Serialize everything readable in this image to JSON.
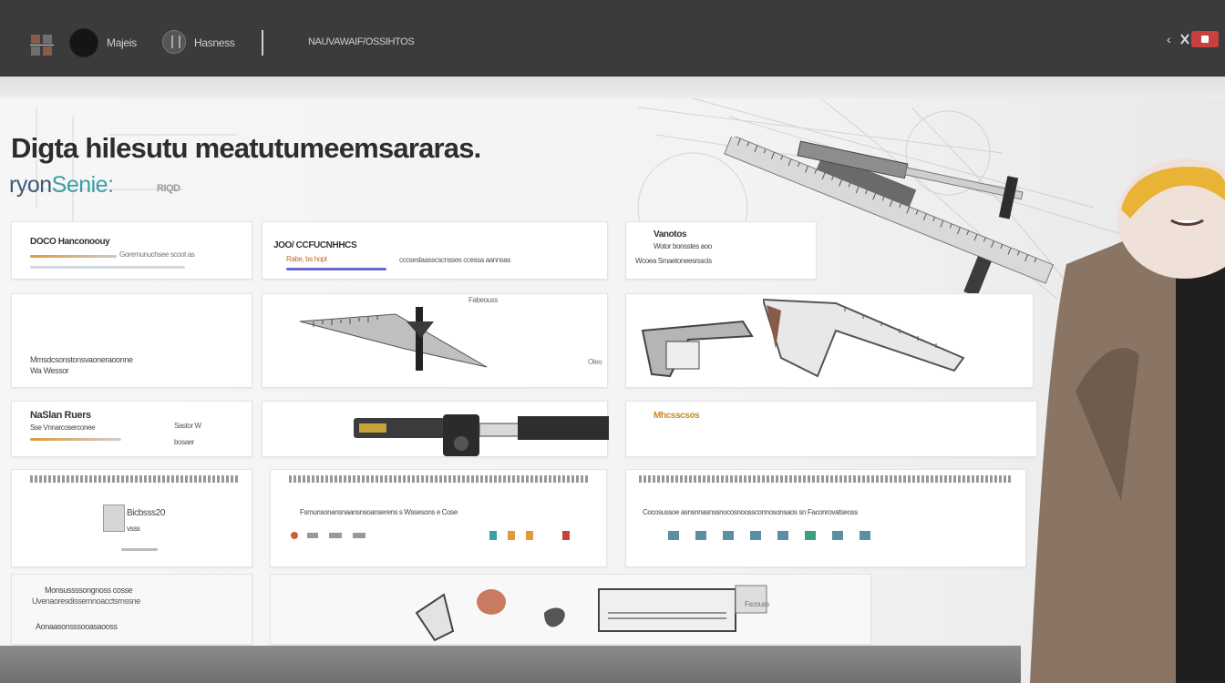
{
  "topbar": {
    "user_name": "Majeis",
    "brand_name": "Hasness",
    "nav_link": "NAUVAWAIF/OSSIHTOS",
    "icons": [
      "grid-logo-icon",
      "avatar",
      "brand-icon",
      "back-icon",
      "tools-icon",
      "record-icon"
    ]
  },
  "hero": {
    "headline": "Digta hilesutu meatutumeemsararas.",
    "subline_a": "ryon",
    "subline_b": "Senie:",
    "badge": "RIQD"
  },
  "cards": {
    "c1": {
      "title": "DOCO Hanconoouy",
      "line": "Gorernunuchsee scoot as"
    },
    "c2": {
      "title": "JOO/ CCFUCNHHCS",
      "line_a": "Rabe, bs hopt",
      "line_b": "cccseslaasscscnsses ccessa aannsas"
    },
    "c3": {
      "title": "Vanotos",
      "line_a": "Wotor bonsstes aoo",
      "line_b": "Wcoea Smaetoneesrsscis"
    },
    "c4": {
      "line_a": "Mmsdcsonstonsvaoneraoonne",
      "line_b": "Wa Wessor"
    },
    "c5": {
      "caption": "Fabeouss"
    },
    "c6": {
      "caption": "Oleo"
    },
    "c7": {
      "title": "NaSlan Ruers",
      "line_a": "Sse Vnnarcoserconee",
      "chip_a": "Sastor W",
      "chip_b": "bosaer"
    },
    "c8": {
      "label": "Mhcsscsos"
    },
    "c9": {
      "title": "Bicbsss20",
      "line": "vsss"
    },
    "c10": {
      "line": "Fsmunsonansnaansnsoanserens s Wssesons e Cose"
    },
    "c11": {
      "line": "Cocosussoe asnsnnasnssnocosnoossconnosonsaos sn Faconrovatseoss"
    },
    "c12": {
      "line_a": "Monsussssongnoss cosse",
      "line_b": "Uvenaoresdissemnoacctsrnssne",
      "line_c": "Aonaasonsssooasaooss"
    },
    "c13": {
      "label": "Fscouss"
    }
  },
  "colors": {
    "topbar": "#3b3b3b",
    "accent_orange": "#e09a3a",
    "accent_teal": "#3a9ea7",
    "accent_red": "#c94040"
  }
}
